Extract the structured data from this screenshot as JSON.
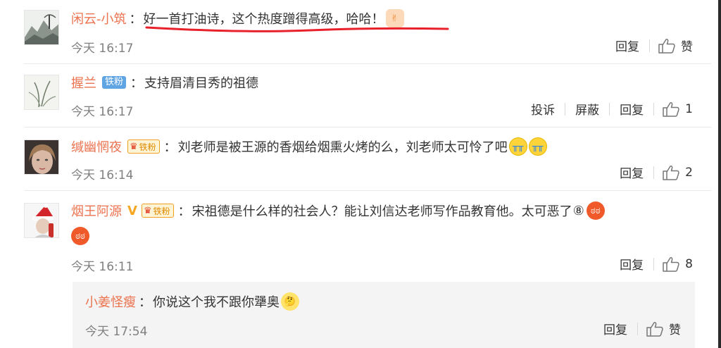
{
  "comments": [
    {
      "username": "闲云-小筑",
      "text": "好一首打油诗，这个热度蹭得高级，哈哈！",
      "emoji": "clapping-hands-icon",
      "time": "今天 16:17",
      "actions": [
        "回复"
      ],
      "like_label": "赞"
    },
    {
      "username": "握兰",
      "badge": "铁粉",
      "text": "支持眉清目秀的祖德",
      "time": "今天 16:17",
      "actions": [
        "投诉",
        "屏蔽",
        "回复"
      ],
      "like_count": "1"
    },
    {
      "username": "缄幽惘夜",
      "badge": "铁粉",
      "text": "刘老师是被王源的香烟给烟熏火烤的么，刘老师太可怜了吧",
      "emoji": [
        "crying-face-icon",
        "crying-face-icon"
      ],
      "time": "今天 16:14",
      "actions": [
        "回复"
      ],
      "like_count": "2"
    },
    {
      "username": "烟王阿源",
      "badge": "铁粉",
      "text": "宋祖德是什么样的社会人？能让刘信达老师写作品教育他。太可恶了",
      "circled": "⑧",
      "emoji": [
        "angry-face-icon",
        "angry-face-icon"
      ],
      "time": "今天 16:11",
      "actions": [
        "回复"
      ],
      "like_count": "8",
      "reply": {
        "username": "小姜怪瘦",
        "text": "你说这个我不跟你犟奥",
        "emoji": "thinking-face-icon",
        "time": "今天 17:54",
        "actions": [
          "回复"
        ],
        "like_label": "赞"
      }
    }
  ]
}
